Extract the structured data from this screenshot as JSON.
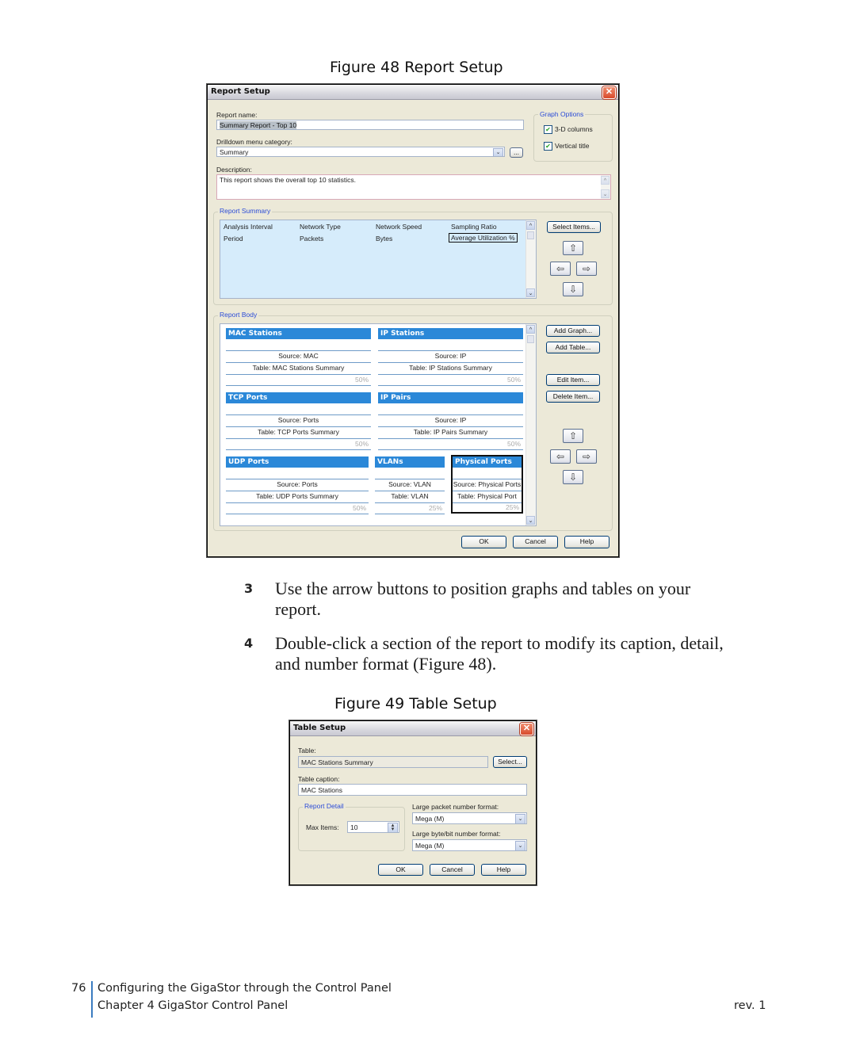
{
  "figure48": {
    "caption": "Figure 48  Report Setup",
    "dialog": {
      "title": "Report Setup",
      "report_name_label": "Report name:",
      "report_name_value": "Summary Report - Top 10",
      "drilldown_label": "Drilldown menu category:",
      "drilldown_value": "Summary",
      "ellipsis_button": "...",
      "description_label": "Description:",
      "description_value": "This report shows the overall top 10 statistics.",
      "graph_options": {
        "title": "Graph Options",
        "items": [
          {
            "label": "3-D columns",
            "checked": true
          },
          {
            "label": "Vertical title",
            "checked": true
          }
        ]
      },
      "report_summary": {
        "title": "Report Summary",
        "rows": [
          [
            "Analysis Interval",
            "Network Type",
            "Network Speed",
            "Sampling Ratio"
          ],
          [
            "Period",
            "Packets",
            "Bytes",
            "Average Utilization %"
          ]
        ],
        "select_items_button": "Select Items..."
      },
      "report_body": {
        "title": "Report Body",
        "sections": [
          {
            "caption": "MAC Stations",
            "source": "Source: MAC",
            "table": "Table: MAC Stations Summary",
            "width": "50%"
          },
          {
            "caption": "IP Stations",
            "source": "Source: IP",
            "table": "Table: IP Stations Summary",
            "width": "50%"
          },
          {
            "caption": "TCP Ports",
            "source": "Source: Ports",
            "table": "Table: TCP Ports Summary",
            "width": "50%"
          },
          {
            "caption": "IP Pairs",
            "source": "Source: IP",
            "table": "Table: IP Pairs Summary",
            "width": "50%"
          },
          {
            "caption": "UDP Ports",
            "source": "Source: Ports",
            "table": "Table: UDP Ports Summary",
            "width": "50%"
          },
          {
            "caption": "VLANs",
            "source": "Source: VLAN",
            "table": "Table: VLAN",
            "width": "25%"
          },
          {
            "caption": "Physical Ports",
            "source": "Source: Physical Ports",
            "table": "Table: Physical Port",
            "width": "25%"
          }
        ],
        "buttons": {
          "add_graph": "Add Graph...",
          "add_table": "Add Table...",
          "edit_item": "Edit Item...",
          "delete_item": "Delete Item..."
        }
      },
      "ok": "OK",
      "cancel": "Cancel",
      "help": "Help"
    }
  },
  "steps": [
    {
      "number": "3",
      "line1": "Use the arrow buttons to position graphs and tables on your",
      "line2": "report."
    },
    {
      "number": "4",
      "line1": "Double-click a section of the report to modify its caption, detail,",
      "line2": "and number format (Figure 48)."
    }
  ],
  "figure49": {
    "caption": "Figure 49  Table Setup",
    "dialog": {
      "title": "Table Setup",
      "table_label": "Table:",
      "table_value": "MAC Stations Summary",
      "select_button": "Select...",
      "caption_label": "Table caption:",
      "caption_value": "MAC Stations",
      "report_detail_title": "Report Detail",
      "max_items_label": "Max Items:",
      "max_items_value": "10",
      "packet_format_label": "Large packet number format:",
      "packet_format_value": "Mega (M)",
      "byte_format_label": "Large byte/bit number format:",
      "byte_format_value": "Mega (M)",
      "ok": "OK",
      "cancel": "Cancel",
      "help": "Help"
    }
  },
  "footer": {
    "page_number": "76",
    "section_title": "Configuring the GigaStor through the Control Panel",
    "chapter": "Chapter 4 GigaStor Control Panel",
    "revision": "rev. 1"
  }
}
